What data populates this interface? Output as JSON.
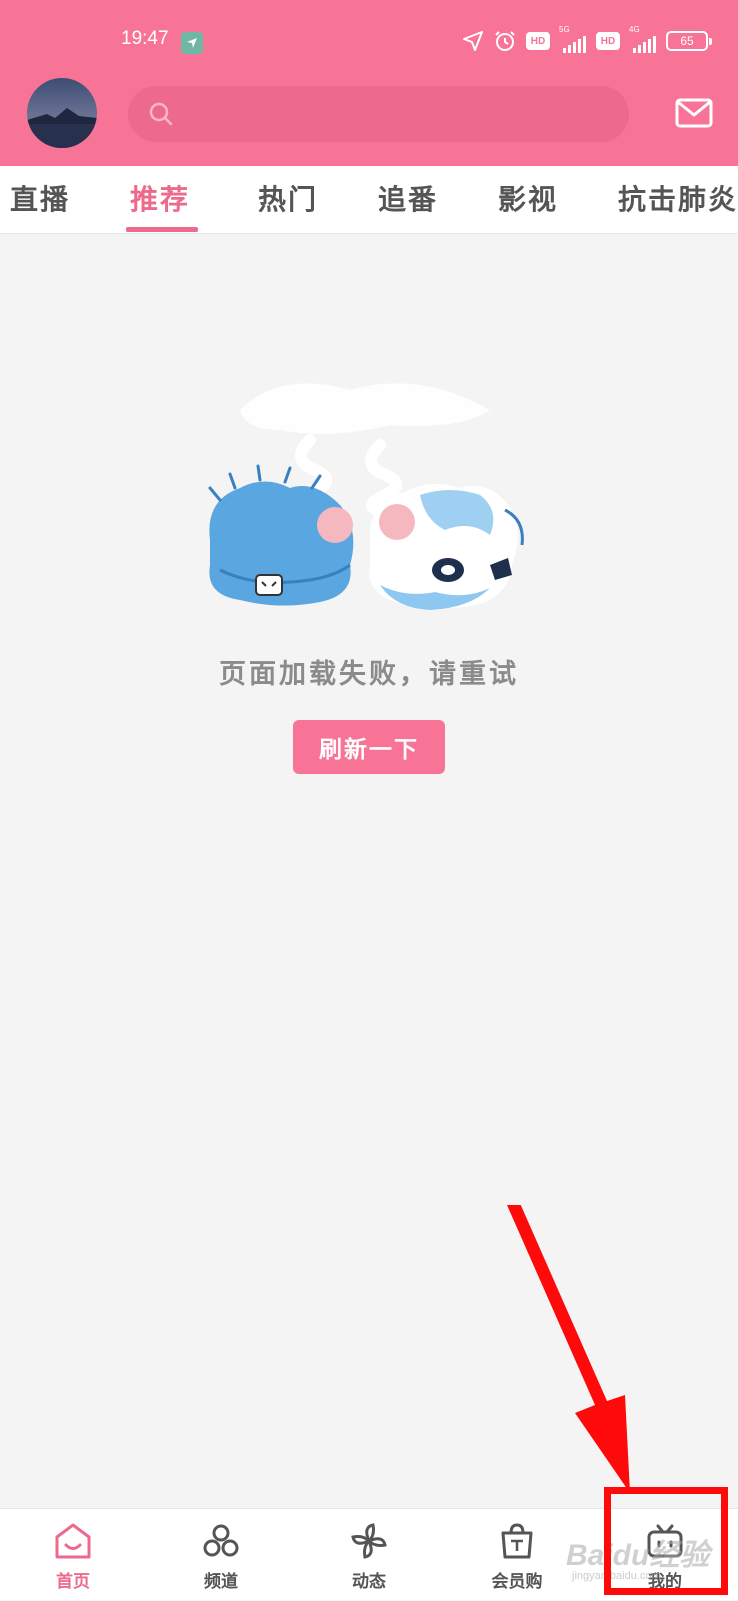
{
  "status_bar": {
    "time": "19:47",
    "hd_1": "HD",
    "signal_1_gen": "5G",
    "hd_2": "HD",
    "signal_2_gen": "4G",
    "battery": "65",
    "icons": [
      "location-arrow-icon",
      "navigation-icon",
      "alarm-icon"
    ]
  },
  "header": {
    "search_placeholder": "",
    "mail_icon": "mail-icon"
  },
  "tabs": [
    {
      "label": "直播",
      "active": false
    },
    {
      "label": "推荐",
      "active": true
    },
    {
      "label": "热门",
      "active": false
    },
    {
      "label": "追番",
      "active": false
    },
    {
      "label": "影视",
      "active": false
    },
    {
      "label": "抗击肺炎",
      "active": false
    }
  ],
  "main": {
    "error_message": "页面加载失败，请重试",
    "refresh_label": "刷新一下"
  },
  "bottom_nav": [
    {
      "label": "首页",
      "icon": "home-tv-icon",
      "active": true
    },
    {
      "label": "频道",
      "icon": "channel-circles-icon",
      "active": false
    },
    {
      "label": "动态",
      "icon": "pinwheel-icon",
      "active": false
    },
    {
      "label": "会员购",
      "icon": "shopping-bag-icon",
      "active": false
    },
    {
      "label": "我的",
      "icon": "tv-icon",
      "active": false
    }
  ],
  "watermark": {
    "text": "Baidu经验",
    "sub": "jingyan.baidu.com"
  },
  "colors": {
    "brand_pink": "#f87497",
    "accent_pink": "#ed6a8d",
    "annotation_red": "#ff0a0a"
  }
}
